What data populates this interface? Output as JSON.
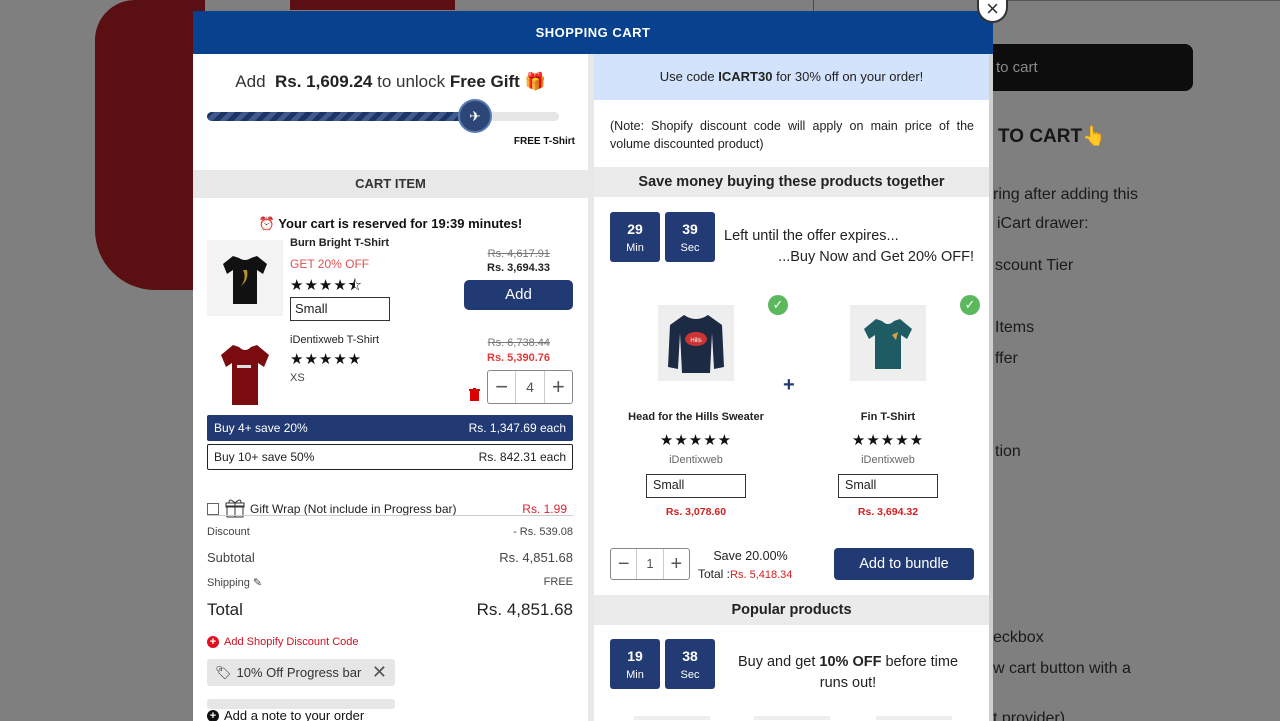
{
  "background": {
    "add_to_cart_fragment": "to cart",
    "heading_fragment": "TO CART👆",
    "lines": [
      "ring after adding this",
      "iCart drawer:",
      "scount Tier",
      "Items",
      "ffer",
      "tion",
      "eckbox",
      "w cart button with a",
      "t provider)"
    ]
  },
  "modal": {
    "title": "SHOPPING CART",
    "close": "×"
  },
  "progress": {
    "prefix": "Add",
    "amount": "Rs. 1,609.24",
    "middle": "to unlock",
    "reward": "Free Gift",
    "gift_emoji": "🎁",
    "fill_fraction": 0.76,
    "milestone_label": "FREE T-Shirt"
  },
  "cart": {
    "section_title": "CART ITEM",
    "reserved_text": "⏰ Your cart is reserved for 19:39 minutes!",
    "items": [
      {
        "name": "Burn Bright T-Shirt",
        "promo": "GET 20% OFF",
        "stars": "★★★★⯪",
        "variant": "Small",
        "old_price": "Rs. 4,617.91",
        "new_price": "Rs. 3,694.33",
        "button": "Add"
      },
      {
        "name": "iDentixweb T-Shirt",
        "stars": "★★★★★",
        "variant": "XS",
        "old_price": "Rs. 6,738.44",
        "new_price": "Rs. 5,390.76",
        "qty": "4"
      }
    ],
    "tiers": [
      {
        "label": "Buy 4+ save 20%",
        "price": "Rs. 1,347.69 each"
      },
      {
        "label": "Buy 10+ save 50%",
        "price": "Rs. 842.31 each"
      }
    ],
    "gift_wrap": {
      "label": "Gift Wrap (Not include in Progress bar)",
      "price": "Rs. 1.99"
    },
    "summary": {
      "discount_label": "Discount",
      "discount_value": "- Rs. 539.08",
      "subtotal_label": "Subtotal",
      "subtotal_value": "Rs. 4,851.68",
      "shipping_label": "Shipping",
      "shipping_value": "FREE",
      "total_label": "Total",
      "total_value": "Rs. 4,851.68"
    },
    "add_discount_code": "Add Shopify Discount Code",
    "applied_code": "10% Off Progress bar",
    "add_note": "Add a note to your order"
  },
  "right": {
    "promo_prefix": "Use code",
    "promo_code": "ICART30",
    "promo_suffix": "for 30% off on your order!",
    "note": "(Note: Shopify discount code will apply on main price of the volume discounted product)",
    "bundle_title": "Save money buying these products together",
    "timer1": {
      "min": "29",
      "sec": "39",
      "min_label": "Min",
      "sec_label": "Sec"
    },
    "offer_line1": "Left until the offer expires...",
    "offer_line2": "...Buy Now and Get 20% OFF!",
    "products": [
      {
        "name": "Head for the Hills Sweater",
        "stars": "★★★★★",
        "vendor": "iDentixweb",
        "variant": "Small",
        "price": "Rs. 3,078.60"
      },
      {
        "name": "Fin T-Shirt",
        "stars": "★★★★★",
        "vendor": "iDentixweb",
        "variant": "Small",
        "price": "Rs. 3,694.32"
      }
    ],
    "bundle_qty": "1",
    "bundle_save": "Save 20.00%",
    "bundle_total_label": "Total :",
    "bundle_total_value": "Rs. 5,418.34",
    "bundle_button": "Add to bundle",
    "popular_title": "Popular products",
    "timer2": {
      "min": "19",
      "sec": "38",
      "min_label": "Min",
      "sec_label": "Sec"
    },
    "popular_prefix": "Buy and get",
    "popular_bold": "10% OFF",
    "popular_suffix": "before time runs out!"
  },
  "colors": {
    "header": "#08428e",
    "accent": "#223a73",
    "promo_bg": "#d3e3fb",
    "sale": "#d02020"
  }
}
